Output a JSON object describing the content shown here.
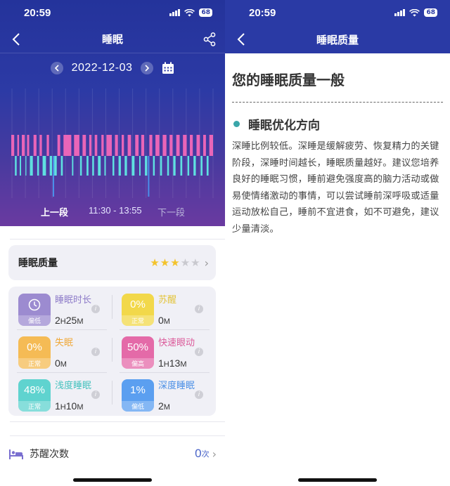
{
  "left": {
    "status": {
      "time": "20:59",
      "battery": "68"
    },
    "header": {
      "title": "睡眠"
    },
    "date": "2022-12-03",
    "chart_labels": {
      "prev": "上一段",
      "range": "11:30 - 13:55",
      "next": "下一段"
    },
    "quality": {
      "title": "睡眠质量",
      "stars": 3,
      "max_stars": 5
    },
    "metrics": [
      {
        "name": "睡眠时长",
        "badge": "",
        "status": "偏低",
        "value": "2",
        "u1": "H",
        "value2": "25",
        "u2": "M",
        "color": "#9c8bd0",
        "name_color": "#8e7cc9",
        "icon": "clock-icon"
      },
      {
        "name": "苏醒",
        "badge": "0%",
        "status": "正常",
        "value": "0",
        "u1": "M",
        "value2": "",
        "u2": "",
        "color": "#f2d84a",
        "name_color": "#e3c43a"
      },
      {
        "name": "失眠",
        "badge": "0%",
        "status": "正常",
        "value": "0",
        "u1": "M",
        "value2": "",
        "u2": "",
        "color": "#f5bb55",
        "name_color": "#f0a93a"
      },
      {
        "name": "快速眼动",
        "badge": "50%",
        "status": "偏高",
        "value": "1",
        "u1": "H",
        "value2": "13",
        "u2": "M",
        "color": "#e46aa8",
        "name_color": "#db5a9a"
      },
      {
        "name": "浅度睡眠",
        "badge": "48%",
        "status": "正常",
        "value": "1",
        "u1": "H",
        "value2": "10",
        "u2": "M",
        "color": "#5fd3cf",
        "name_color": "#45c2be"
      },
      {
        "name": "深度睡眠",
        "badge": "1%",
        "status": "偏低",
        "value": "2",
        "u1": "M",
        "value2": "",
        "u2": "",
        "color": "#5b9ff0",
        "name_color": "#4a8fe6"
      }
    ],
    "wake": {
      "title": "苏醒次数",
      "value": "0",
      "unit": "次"
    }
  },
  "right": {
    "status": {
      "time": "20:59",
      "battery": "68"
    },
    "header": {
      "title": "睡眠质量"
    },
    "headline": "您的睡眠质量一般",
    "section_title": "睡眠优化方向",
    "paragraph": "深睡比例较低。深睡是缓解疲劳、恢复精力的关键阶段，深睡时间越长，睡眠质量越好。建议您培养良好的睡眠习惯，睡前避免强度高的脑力活动或做易使情绪激动的事情，可以尝试睡前深呼吸或适量运动放松自己，睡前不宜进食，如不可避免，建议少量清淡。"
  },
  "colors": {
    "rem": "#e965b8",
    "light": "#5fe0e0",
    "deep": "#4a8fea",
    "star_on": "#f3c32c",
    "star_off": "#c9c9cf"
  },
  "chart_data": {
    "type": "timeline",
    "time_range": [
      "11:30",
      "13:55"
    ],
    "stages": [
      "rem",
      "light",
      "deep"
    ],
    "segments": [
      {
        "stage": "rem",
        "start": 0.0,
        "end": 0.018
      },
      {
        "stage": "light",
        "start": 0.018,
        "end": 0.03
      },
      {
        "stage": "rem",
        "start": 0.03,
        "end": 0.042
      },
      {
        "stage": "light",
        "start": 0.042,
        "end": 0.052
      },
      {
        "stage": "rem",
        "start": 0.052,
        "end": 0.07
      },
      {
        "stage": "light",
        "start": 0.07,
        "end": 0.078
      },
      {
        "stage": "rem",
        "start": 0.078,
        "end": 0.092
      },
      {
        "stage": "light",
        "start": 0.092,
        "end": 0.11
      },
      {
        "stage": "rem",
        "start": 0.11,
        "end": 0.128
      },
      {
        "stage": "light",
        "start": 0.128,
        "end": 0.14
      },
      {
        "stage": "rem",
        "start": 0.14,
        "end": 0.155
      },
      {
        "stage": "light",
        "start": 0.155,
        "end": 0.175
      },
      {
        "stage": "rem",
        "start": 0.175,
        "end": 0.19
      },
      {
        "stage": "light",
        "start": 0.19,
        "end": 0.205
      },
      {
        "stage": "deep",
        "start": 0.205,
        "end": 0.212
      },
      {
        "stage": "light",
        "start": 0.212,
        "end": 0.228
      },
      {
        "stage": "rem",
        "start": 0.228,
        "end": 0.245
      },
      {
        "stage": "light",
        "start": 0.245,
        "end": 0.258
      },
      {
        "stage": "rem",
        "start": 0.258,
        "end": 0.3
      },
      {
        "stage": "light",
        "start": 0.3,
        "end": 0.31
      },
      {
        "stage": "rem",
        "start": 0.31,
        "end": 0.34
      },
      {
        "stage": "light",
        "start": 0.34,
        "end": 0.352
      },
      {
        "stage": "rem",
        "start": 0.352,
        "end": 0.372
      },
      {
        "stage": "light",
        "start": 0.372,
        "end": 0.385
      },
      {
        "stage": "rem",
        "start": 0.385,
        "end": 0.4
      },
      {
        "stage": "light",
        "start": 0.4,
        "end": 0.412
      },
      {
        "stage": "rem",
        "start": 0.412,
        "end": 0.428
      },
      {
        "stage": "light",
        "start": 0.428,
        "end": 0.445
      },
      {
        "stage": "rem",
        "start": 0.445,
        "end": 0.46
      },
      {
        "stage": "light",
        "start": 0.46,
        "end": 0.47
      },
      {
        "stage": "rem",
        "start": 0.47,
        "end": 0.5
      },
      {
        "stage": "light",
        "start": 0.5,
        "end": 0.512
      },
      {
        "stage": "rem",
        "start": 0.512,
        "end": 0.53
      },
      {
        "stage": "light",
        "start": 0.53,
        "end": 0.545
      },
      {
        "stage": "rem",
        "start": 0.545,
        "end": 0.56
      },
      {
        "stage": "light",
        "start": 0.56,
        "end": 0.575
      },
      {
        "stage": "rem",
        "start": 0.575,
        "end": 0.595
      },
      {
        "stage": "light",
        "start": 0.595,
        "end": 0.612
      },
      {
        "stage": "rem",
        "start": 0.612,
        "end": 0.632
      },
      {
        "stage": "light",
        "start": 0.632,
        "end": 0.642
      },
      {
        "stage": "rem",
        "start": 0.642,
        "end": 0.66
      },
      {
        "stage": "light",
        "start": 0.66,
        "end": 0.675
      },
      {
        "stage": "deep",
        "start": 0.675,
        "end": 0.682
      },
      {
        "stage": "rem",
        "start": 0.682,
        "end": 0.7
      },
      {
        "stage": "light",
        "start": 0.7,
        "end": 0.712
      },
      {
        "stage": "rem",
        "start": 0.712,
        "end": 0.735
      },
      {
        "stage": "light",
        "start": 0.735,
        "end": 0.748
      },
      {
        "stage": "rem",
        "start": 0.748,
        "end": 0.77
      },
      {
        "stage": "light",
        "start": 0.77,
        "end": 0.782
      },
      {
        "stage": "rem",
        "start": 0.782,
        "end": 0.8
      },
      {
        "stage": "light",
        "start": 0.8,
        "end": 0.815
      },
      {
        "stage": "rem",
        "start": 0.815,
        "end": 0.835
      },
      {
        "stage": "light",
        "start": 0.835,
        "end": 0.848
      },
      {
        "stage": "rem",
        "start": 0.848,
        "end": 0.87
      },
      {
        "stage": "light",
        "start": 0.87,
        "end": 0.882
      },
      {
        "stage": "rem",
        "start": 0.882,
        "end": 0.9
      },
      {
        "stage": "light",
        "start": 0.9,
        "end": 0.915
      },
      {
        "stage": "rem",
        "start": 0.915,
        "end": 0.935
      },
      {
        "stage": "light",
        "start": 0.935,
        "end": 0.948
      },
      {
        "stage": "rem",
        "start": 0.948,
        "end": 0.965
      },
      {
        "stage": "light",
        "start": 0.965,
        "end": 0.978
      },
      {
        "stage": "rem",
        "start": 0.978,
        "end": 1.0
      }
    ]
  }
}
